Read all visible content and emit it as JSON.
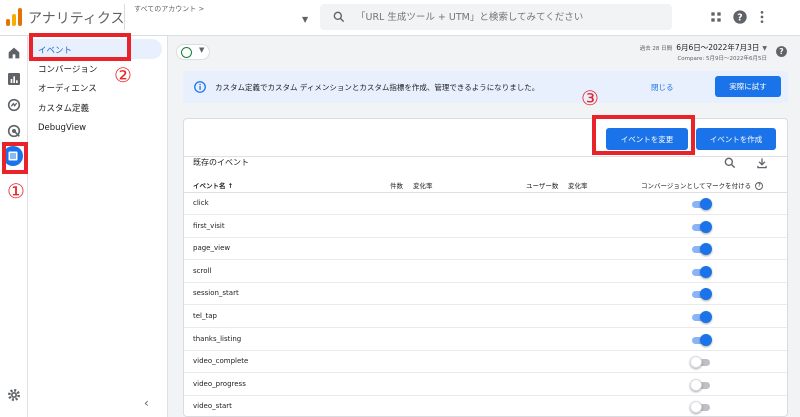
{
  "header": {
    "app_title": "アナリティクス",
    "account_label": "すべてのアカウント >",
    "search_placeholder": "「URL 生成ツール + UTM」と検索してみてください"
  },
  "nav": {
    "items": [
      {
        "label": "イベント"
      },
      {
        "label": "コンバージョン"
      },
      {
        "label": "オーディエンス"
      },
      {
        "label": "カスタム定義"
      },
      {
        "label": "DebugView"
      }
    ]
  },
  "date_range": {
    "prefix": "過去 28 日間",
    "range": "6月6日～2022年7月3日",
    "compare": "Compare: 5月9日～2022年6月5日"
  },
  "banner": {
    "text": "カスタム定義でカスタム ディメンションとカスタム指標を作成、管理できるようになりました。",
    "close_label": "閉じる",
    "try_label": "実際に試す"
  },
  "buttons": {
    "modify_event": "イベントを変更",
    "create_event": "イベントを作成"
  },
  "table": {
    "title": "既存のイベント",
    "headers": {
      "event_name": "イベント名 ↑",
      "count": "件数",
      "change_rate": "変化率",
      "users": "ユーザー数",
      "users_change_rate": "変化率",
      "mark_as_conversion": "コンバージョンとしてマークを付ける"
    },
    "rows": [
      {
        "name": "click",
        "conversion": true
      },
      {
        "name": "first_visit",
        "conversion": true
      },
      {
        "name": "page_view",
        "conversion": true
      },
      {
        "name": "scroll",
        "conversion": true
      },
      {
        "name": "session_start",
        "conversion": true
      },
      {
        "name": "tel_tap",
        "conversion": true
      },
      {
        "name": "thanks_listing",
        "conversion": true
      },
      {
        "name": "video_complete",
        "conversion": false
      },
      {
        "name": "video_progress",
        "conversion": false
      },
      {
        "name": "video_start",
        "conversion": false
      }
    ]
  },
  "annotations": [
    "①",
    "②",
    "③"
  ],
  "colors": {
    "accent": "#1a73e8",
    "annotation": "#e8232a",
    "banner_bg": "#e8f0fe"
  }
}
